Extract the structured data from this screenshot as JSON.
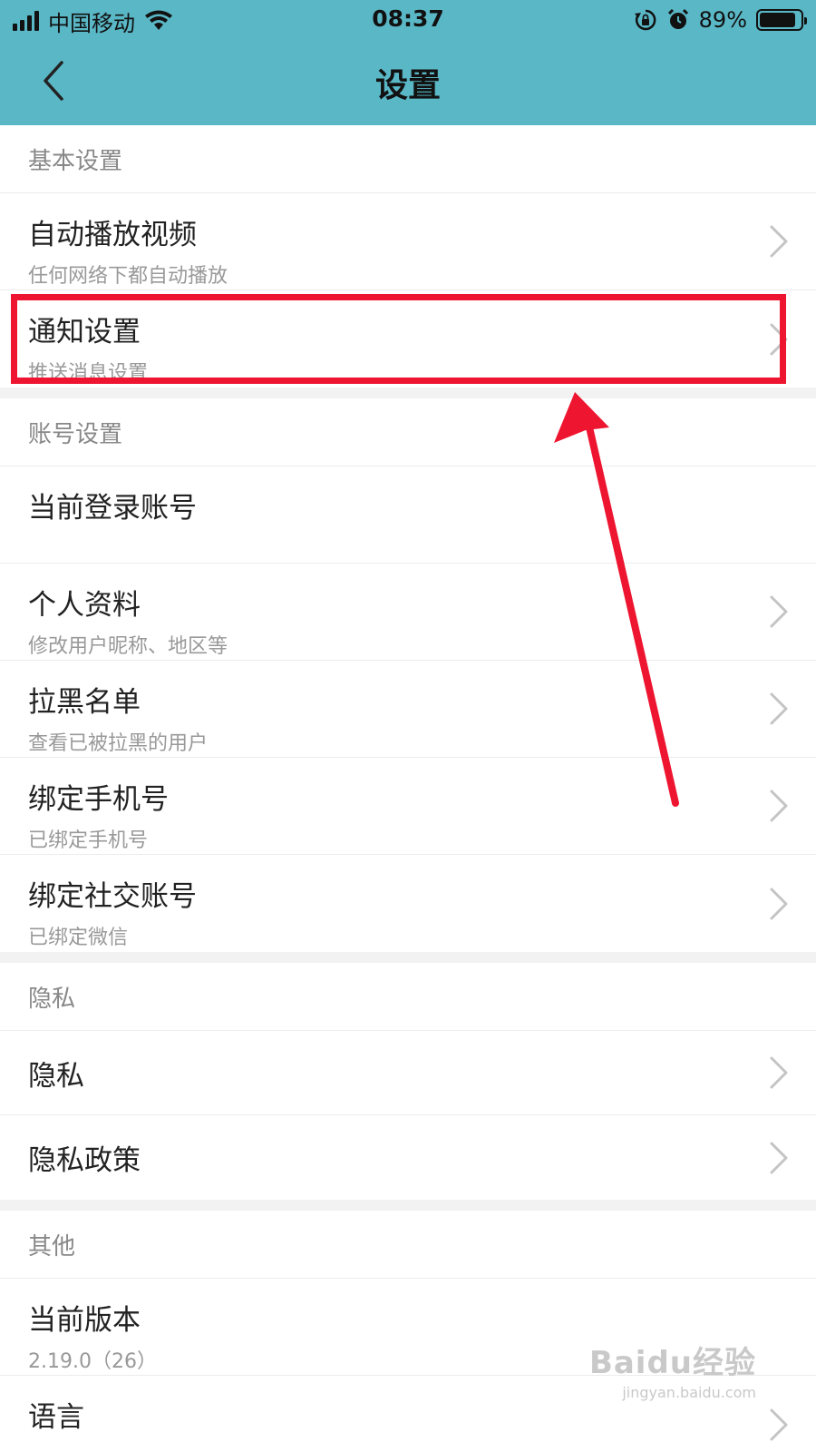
{
  "status_bar": {
    "carrier": "中国移动",
    "time": "08:37",
    "battery": "89%",
    "battery_level": 0.89
  },
  "nav": {
    "title": "设置",
    "back_icon": "chevron-left-icon"
  },
  "sections": [
    {
      "header": "基本设置",
      "items": [
        {
          "title": "自动播放视频",
          "subtitle": "任何网络下都自动播放"
        },
        {
          "title": "通知设置",
          "subtitle": "推送消息设置"
        }
      ]
    },
    {
      "header": "账号设置",
      "items": [
        {
          "title": "当前登录账号",
          "subtitle": ""
        },
        {
          "title": "个人资料",
          "subtitle": "修改用户昵称、地区等"
        },
        {
          "title": "拉黑名单",
          "subtitle": "查看已被拉黑的用户"
        },
        {
          "title": "绑定手机号",
          "subtitle": "已绑定手机号"
        },
        {
          "title": "绑定社交账号",
          "subtitle": "已绑定微信"
        }
      ]
    },
    {
      "header": "隐私",
      "items": [
        {
          "title": "隐私"
        },
        {
          "title": "隐私政策"
        }
      ]
    },
    {
      "header": "其他",
      "items": [
        {
          "title": "当前版本",
          "subtitle": "2.19.0（26）"
        },
        {
          "title": "语言"
        }
      ]
    }
  ],
  "watermark": {
    "logo": "Baidu经验",
    "url": "jingyan.baidu.com"
  },
  "colors": {
    "header_bg": "#5ab7c6",
    "annotation": "#ee1530"
  }
}
